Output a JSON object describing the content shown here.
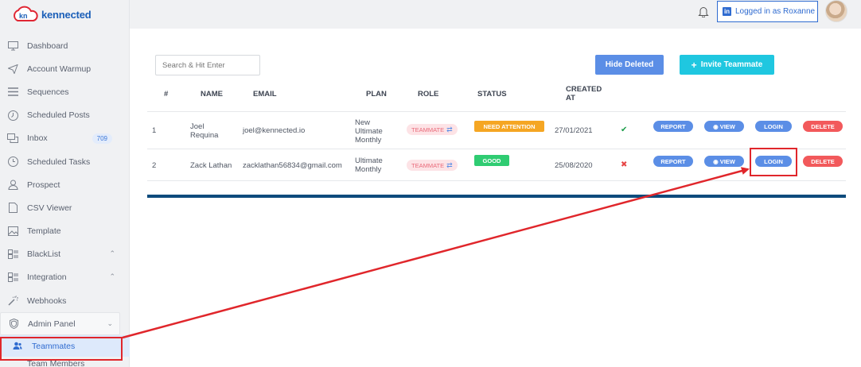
{
  "brand": {
    "mark": "kn",
    "name": "kennected"
  },
  "header": {
    "login_label": "Logged in as Roxanne",
    "linkedin_glyph": "in"
  },
  "sidebar": {
    "items": [
      {
        "label": "Dashboard",
        "icon": "monitor-icon"
      },
      {
        "label": "Account Warmup",
        "icon": "send-icon"
      },
      {
        "label": "Sequences",
        "icon": "list-icon"
      },
      {
        "label": "Scheduled Posts",
        "icon": "clock-icon"
      },
      {
        "label": "Inbox",
        "icon": "chat-icon",
        "badge": "709"
      },
      {
        "label": "Scheduled Tasks",
        "icon": "clock-icon"
      },
      {
        "label": "Prospect",
        "icon": "user-icon"
      },
      {
        "label": "CSV Viewer",
        "icon": "file-icon"
      },
      {
        "label": "Template",
        "icon": "image-icon"
      },
      {
        "label": "BlackList",
        "icon": "grid-icon"
      },
      {
        "label": "Integration",
        "icon": "grid-icon"
      },
      {
        "label": "Webhooks",
        "icon": "wand-icon"
      },
      {
        "label": "Admin Panel",
        "icon": "shield-icon"
      },
      {
        "label": "Teammates",
        "icon": "users-icon"
      },
      {
        "label": "Team Members",
        "icon": "user-icon"
      }
    ]
  },
  "toolbar": {
    "search_placeholder": "Search & Hit Enter",
    "hide_deleted_label": "Hide Deleted",
    "invite_label": "Invite Teammate",
    "invite_glyph": "+"
  },
  "table": {
    "headers": {
      "index": "#",
      "name": "NAME",
      "email": "EMAIL",
      "plan": "PLAN",
      "role": "ROLE",
      "status": "STATUS",
      "created": "CREATED AT"
    },
    "action_labels": {
      "report": "REPORT",
      "view": "VIEW",
      "login": "LOGIN",
      "delete": "DELETE"
    },
    "rows": [
      {
        "index": "1",
        "name": "Joel Requina",
        "email": "joel@kennected.io",
        "plan": "New Ultimate Monthly",
        "role": "TEAMMATE",
        "status": "NEED ATTENTION",
        "created": "27/01/2021",
        "user_state_icon": "user-check-icon"
      },
      {
        "index": "2",
        "name": "Zack Lathan",
        "email": "zacklathan56834@gmail.com",
        "plan": "Ultimate Monthly",
        "role": "TEAMMATE",
        "status": "GOOD",
        "created": "25/08/2020",
        "user_state_icon": "user-x-icon"
      }
    ]
  },
  "colors": {
    "primary": "#5b8ee6",
    "accent": "#1fc7e0",
    "attention": "#f5a623",
    "good": "#2fcc72",
    "danger": "#f2595b",
    "annotation": "#e0262b"
  }
}
